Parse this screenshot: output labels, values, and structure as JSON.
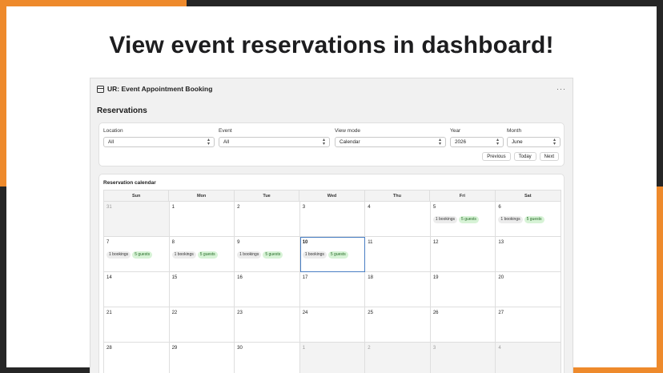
{
  "headline": "View event reservations in dashboard!",
  "app": {
    "title": "UR: Event Appointment Booking",
    "more": "···",
    "section_title": "Reservations"
  },
  "filters": {
    "location": {
      "label": "Location",
      "value": "All"
    },
    "event": {
      "label": "Event",
      "value": "All"
    },
    "view_mode": {
      "label": "View mode",
      "value": "Calendar"
    },
    "year": {
      "label": "Year",
      "value": "2026"
    },
    "month": {
      "label": "Month",
      "value": "June"
    }
  },
  "nav": {
    "previous": "Previous",
    "today": "Today",
    "next": "Next"
  },
  "calendar": {
    "title": "Reservation calendar",
    "weekdays": [
      "Sun",
      "Mon",
      "Tue",
      "Wed",
      "Thu",
      "Fri",
      "Sat"
    ],
    "weeks": [
      [
        {
          "day": "31",
          "muted": true
        },
        {
          "day": "1"
        },
        {
          "day": "2"
        },
        {
          "day": "3"
        },
        {
          "day": "4"
        },
        {
          "day": "5",
          "bookings": "1 bookings",
          "guests": "5 guests"
        },
        {
          "day": "6",
          "bookings": "1 bookings",
          "guests": "5 guests"
        }
      ],
      [
        {
          "day": "7",
          "bookings": "1 bookings",
          "guests": "5 guests"
        },
        {
          "day": "8",
          "bookings": "1 bookings",
          "guests": "5 guests"
        },
        {
          "day": "9",
          "bookings": "1 bookings",
          "guests": "5 guests"
        },
        {
          "day": "10",
          "today": true,
          "bookings": "1 bookings",
          "guests": "5 guests"
        },
        {
          "day": "11"
        },
        {
          "day": "12"
        },
        {
          "day": "13"
        }
      ],
      [
        {
          "day": "14"
        },
        {
          "day": "15"
        },
        {
          "day": "16"
        },
        {
          "day": "17"
        },
        {
          "day": "18"
        },
        {
          "day": "19"
        },
        {
          "day": "20"
        }
      ],
      [
        {
          "day": "21"
        },
        {
          "day": "22"
        },
        {
          "day": "23"
        },
        {
          "day": "24"
        },
        {
          "day": "25"
        },
        {
          "day": "26"
        },
        {
          "day": "27"
        }
      ],
      [
        {
          "day": "28"
        },
        {
          "day": "29"
        },
        {
          "day": "30"
        },
        {
          "day": "1",
          "muted": true
        },
        {
          "day": "2",
          "muted": true
        },
        {
          "day": "3",
          "muted": true
        },
        {
          "day": "4",
          "muted": true
        }
      ]
    ]
  },
  "colors": {
    "accent_orange": "#ee8a2c",
    "dark": "#262626",
    "today_outline": "#4a7fc4",
    "guest_badge": "#d7f3d6"
  }
}
